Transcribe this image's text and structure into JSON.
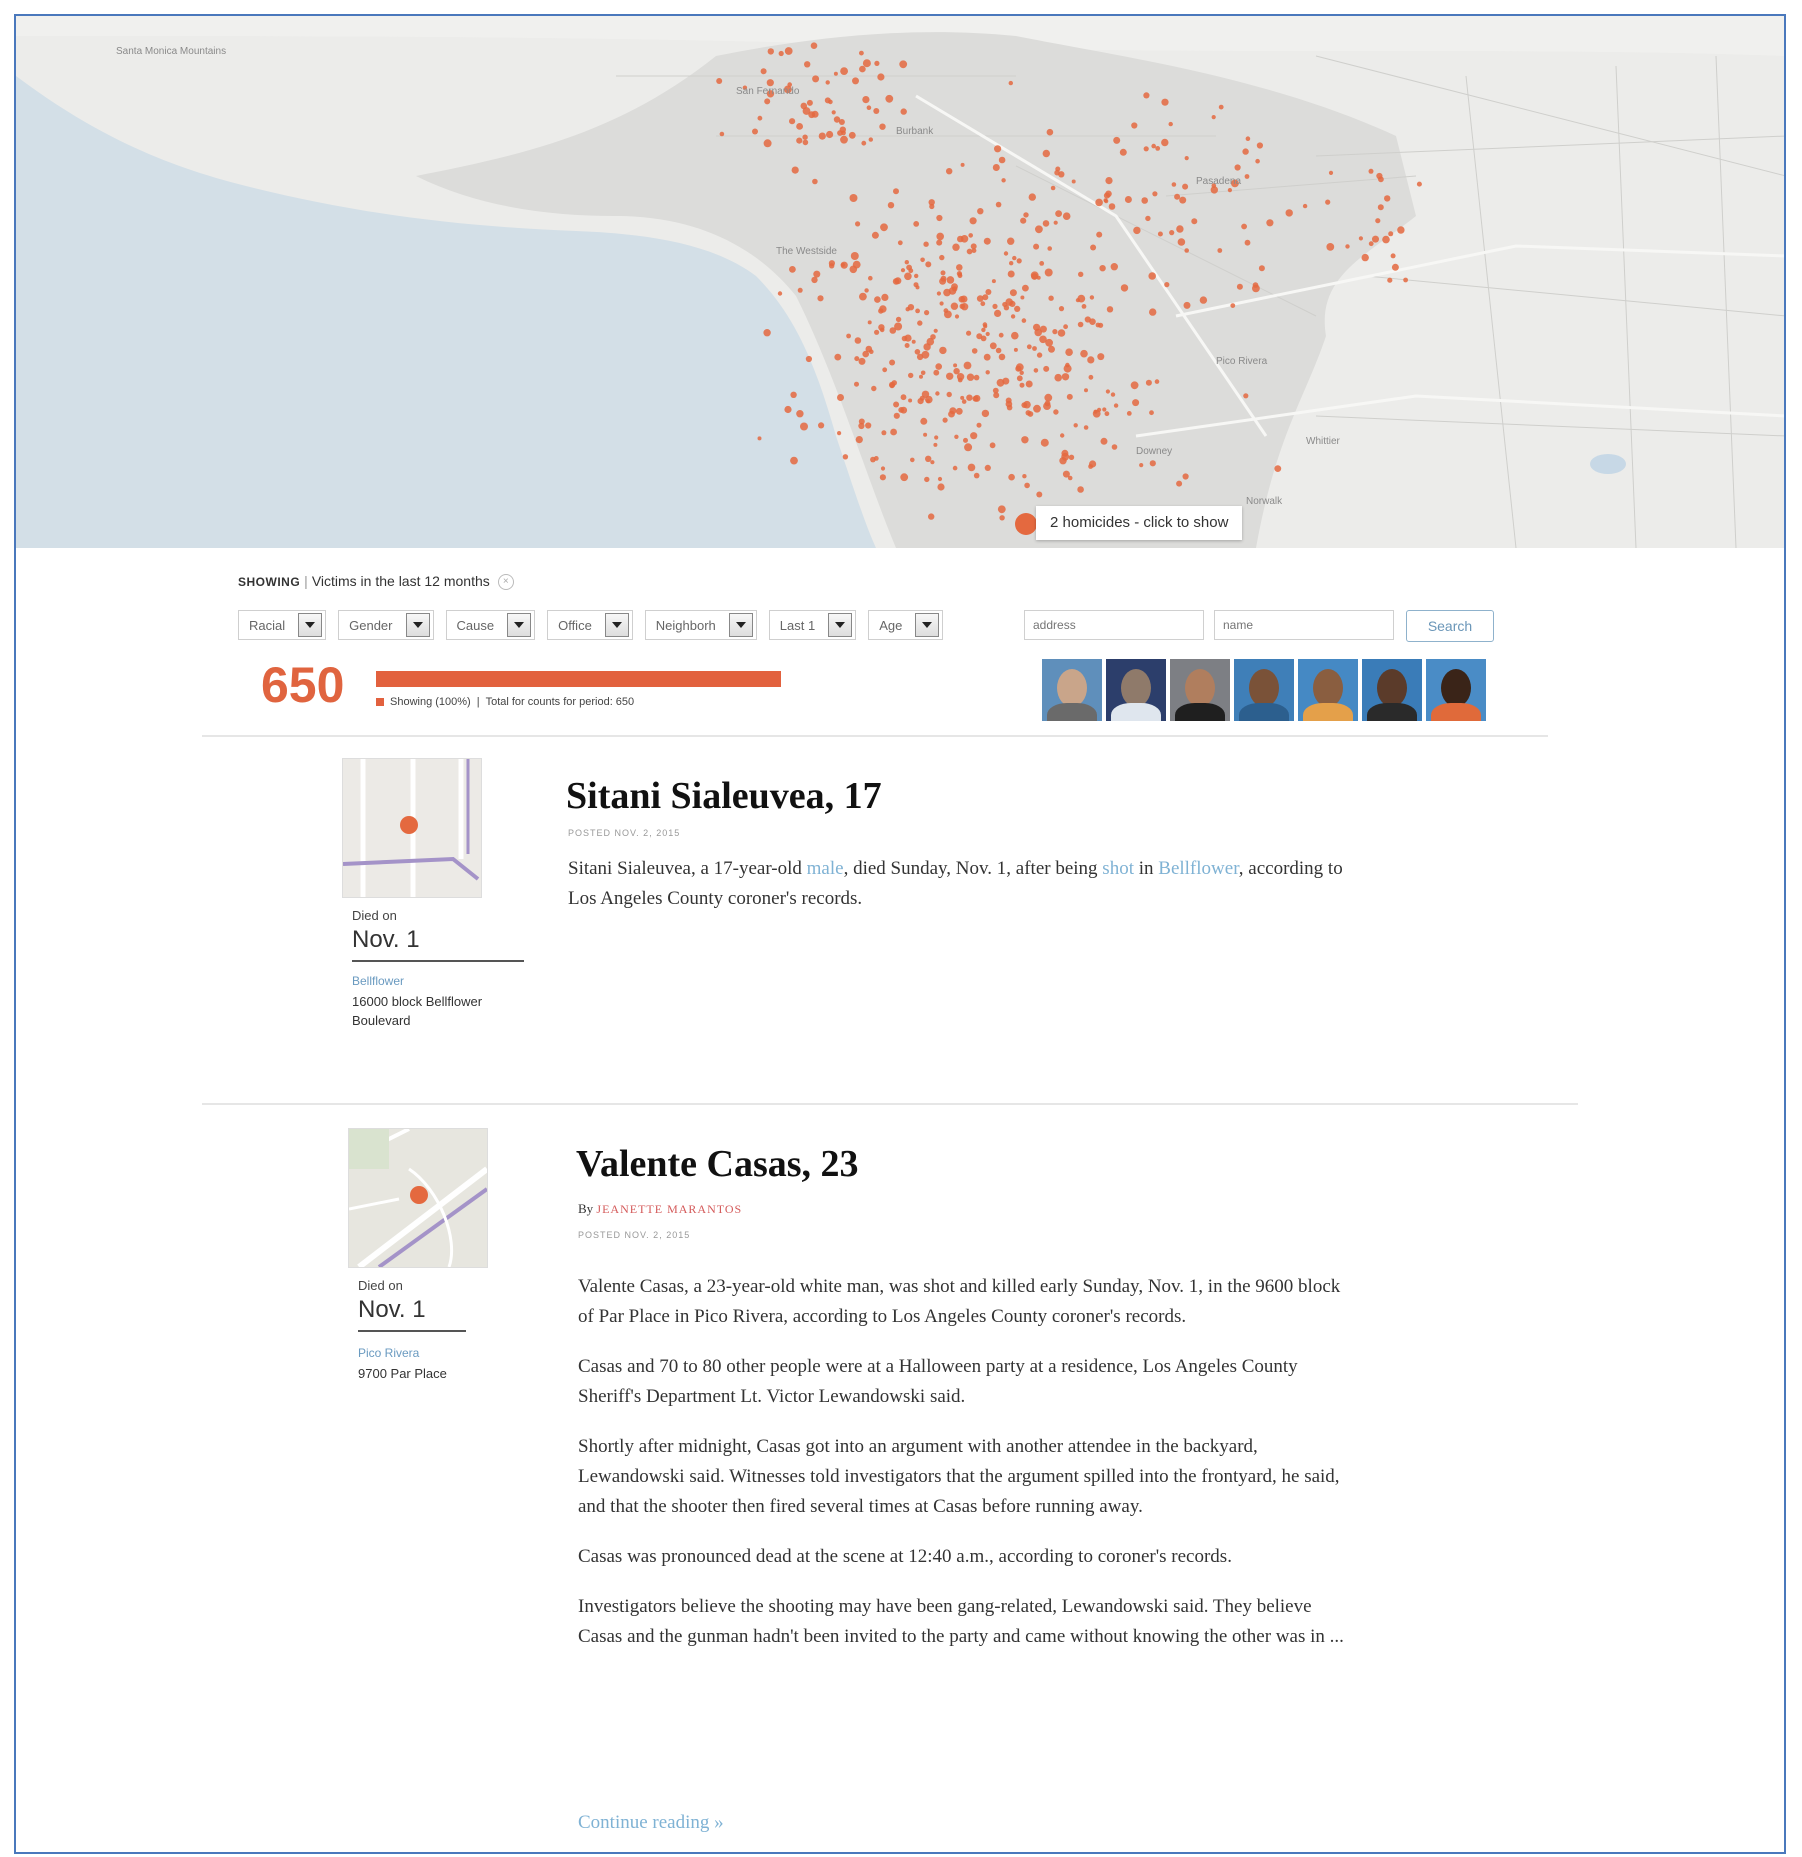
{
  "map": {
    "tooltip": "2 homicides - click to show",
    "places": [
      "Santa Monica Mountains",
      "San Fernando",
      "Burbank",
      "Pasadena",
      "The Westside",
      "Pico Rivera",
      "Whittier",
      "Downey",
      "Norwalk"
    ],
    "colors": {
      "dot": "#e4693f",
      "water": "#d3dfe7",
      "land": "#ececea",
      "highlight": "#d6d6d4"
    }
  },
  "filters": {
    "showing_label": "SHOWING",
    "showing_text": "Victims in the last 12 months",
    "selects": [
      "Racial",
      "Gender",
      "Cause",
      "Office",
      "Neighborh",
      "Last 1",
      "Age"
    ],
    "address_placeholder": "address",
    "name_placeholder": "name",
    "search_label": "Search"
  },
  "summary": {
    "count": "650",
    "bar_fraction": 1.0,
    "legend_showing": "Showing (100%)",
    "legend_total": "Total for counts for period: 650"
  },
  "victim_photos": [
    "victim-photo-1",
    "victim-photo-2",
    "victim-photo-3",
    "victim-photo-4",
    "victim-photo-5",
    "victim-photo-6",
    "victim-photo-7"
  ],
  "articles": [
    {
      "title": "Sitani Sialeuvea, 17",
      "posted": "POSTED NOV. 2, 2015",
      "died_label": "Died on",
      "died_date": "Nov. 1",
      "neighborhood": "Bellflower",
      "address": "16000 block Bellflower Boulevard",
      "body_1": "Sitani Sialeuvea, a 17-year-old ",
      "link_gender": "male",
      "body_2": ", died Sunday, Nov. 1, after being ",
      "link_cause": "shot",
      "body_3": " in ",
      "link_place": "Bellflower",
      "body_4": ", according to Los Angeles County coroner's records."
    },
    {
      "title": "Valente Casas, 23",
      "by": "By",
      "author": "JEANETTE MARANTOS",
      "posted": "POSTED NOV. 2, 2015",
      "died_label": "Died on",
      "died_date": "Nov. 1",
      "neighborhood": "Pico Rivera",
      "address": "9700 Par Place",
      "paragraphs": [
        "Valente Casas, a 23-year-old white man, was shot and killed early Sunday, Nov. 1, in the 9600 block of Par Place in Pico Rivera, according to Los Angeles County coroner's records.",
        "Casas and 70 to 80 other people were at a Halloween party at a residence, Los Angeles County Sheriff's Department Lt. Victor Lewandowski said.",
        "Shortly after midnight, Casas got into an argument with another attendee in the backyard, Lewandowski said. Witnesses told investigators that the argument spilled into the frontyard, he said, and that the shooter then fired several times at Casas before running away.",
        "Casas was pronounced dead at the scene at 12:40 a.m., according to coroner's records.",
        "Investigators believe the shooting may have been gang-related, Lewandowski said. They believe Casas and the gunman hadn't been invited to the party and came without knowing the other was in ..."
      ],
      "continue": "Continue reading »"
    }
  ]
}
